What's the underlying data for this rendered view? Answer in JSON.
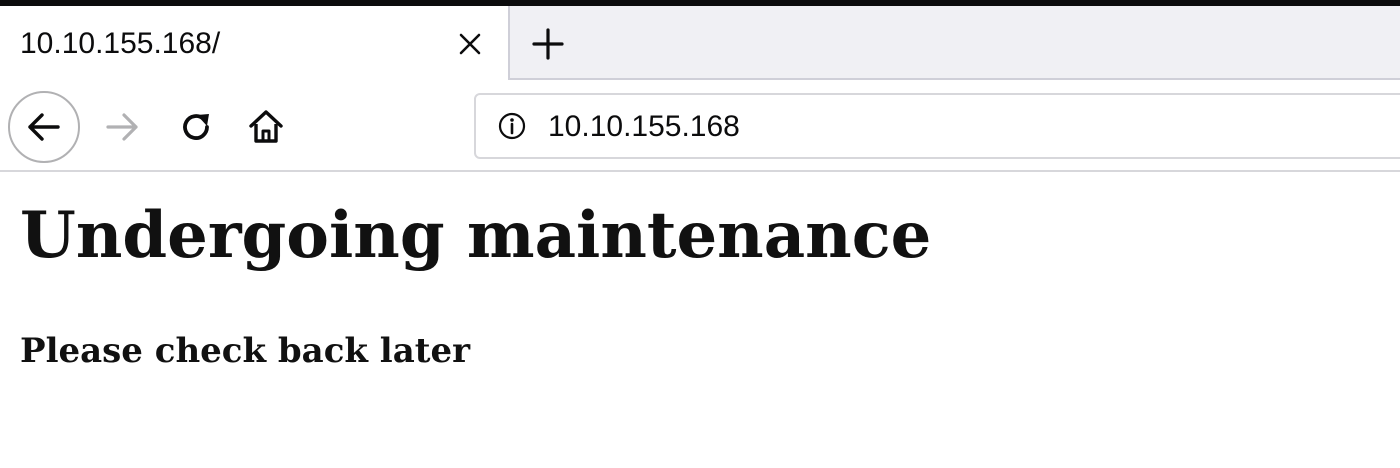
{
  "browser": {
    "tab": {
      "title": "10.10.155.168/",
      "close_icon": "close-icon"
    },
    "new_tab_icon": "plus-icon",
    "nav": {
      "back_icon": "arrow-left-icon",
      "forward_icon": "arrow-right-icon",
      "reload_icon": "reload-icon",
      "home_icon": "home-icon"
    },
    "urlbar": {
      "site_info_icon": "info-icon",
      "url": "10.10.155.168"
    }
  },
  "page": {
    "heading": "Undergoing maintenance",
    "subheading": "Please check back later"
  },
  "colors": {
    "text": "#0c0c0d",
    "disabled_icon": "#b1b1b3",
    "toolbar_border": "#d7d7db"
  }
}
